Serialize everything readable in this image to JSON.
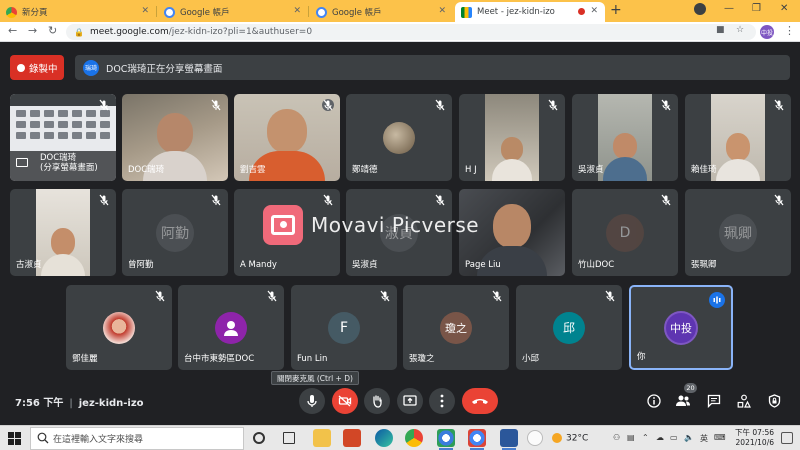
{
  "browser": {
    "tabs": [
      {
        "label": "新分頁",
        "favicon": "chrome-icon"
      },
      {
        "label": "Google 帳戶",
        "favicon": "google-icon"
      },
      {
        "label": "Google 帳戶",
        "favicon": "google-icon"
      },
      {
        "label": "Meet - jez-kidn-izo",
        "favicon": "meet-icon",
        "active": true
      }
    ],
    "new_tab": "+",
    "url_host": "meet.google.com",
    "url_path": "/jez-kidn-izo?pli=1&authuser=0",
    "profile_initials": "中投"
  },
  "meet": {
    "recording_label": "錄製中",
    "presenting_avatar": "瑞琦",
    "presenting_text": "DOC瑞琦正在分享螢幕畫面",
    "participants_row1": [
      {
        "name": "DOC瑞琦\n(分享螢幕畫面)",
        "kind": "screen"
      },
      {
        "name": "DOC瑞琦",
        "kind": "video"
      },
      {
        "name": "劉吉雲",
        "kind": "video"
      },
      {
        "name": "鄭靖德",
        "kind": "video"
      },
      {
        "name": "H J",
        "kind": "video"
      },
      {
        "name": "吳淑貞",
        "kind": "video"
      },
      {
        "name": "賴佳琦",
        "kind": "video"
      }
    ],
    "participants_row2": [
      {
        "name": "古淑貞",
        "kind": "video"
      },
      {
        "name": "曾阿勤",
        "kind": "avatar",
        "avatar_text": "阿勤"
      },
      {
        "name": "A Mandy",
        "kind": "blank"
      },
      {
        "name": "吳淑貞",
        "kind": "avatar",
        "avatar_text": "淑貞"
      },
      {
        "name": "Page Liu",
        "kind": "video"
      },
      {
        "name": "竹山DOC",
        "kind": "avatar",
        "avatar_text": "D"
      },
      {
        "name": "張珮卿",
        "kind": "avatar",
        "avatar_text": "珮卿"
      }
    ],
    "participants_row3": [
      {
        "name": "鄧佳麗",
        "kind": "photo"
      },
      {
        "name": "台中市東勢區DOC",
        "kind": "avatar",
        "avatar_text": ""
      },
      {
        "name": "Fun Lin",
        "kind": "avatar",
        "avatar_text": "F"
      },
      {
        "name": "張瓊之",
        "kind": "avatar",
        "avatar_text": "瓊之"
      },
      {
        "name": "小邱",
        "kind": "avatar",
        "avatar_text": "邱"
      },
      {
        "name": "你",
        "kind": "avatar",
        "avatar_text": "中投"
      }
    ],
    "watermark": "Movavi Picverse",
    "tooltip": "關閉麥克風 (Ctrl + D)",
    "time": "7:56 下午",
    "meeting_code": "jez-kidn-izo",
    "participant_count": "20",
    "colors": {
      "record": "#d93025",
      "hangup": "#ea4335",
      "accent": "#1a73e8"
    }
  },
  "taskbar": {
    "search_placeholder": "在這裡輸入文字來搜尋",
    "temperature": "32°C",
    "ime": "英",
    "clock_time": "下午 07:56",
    "clock_date": "2021/10/6"
  }
}
